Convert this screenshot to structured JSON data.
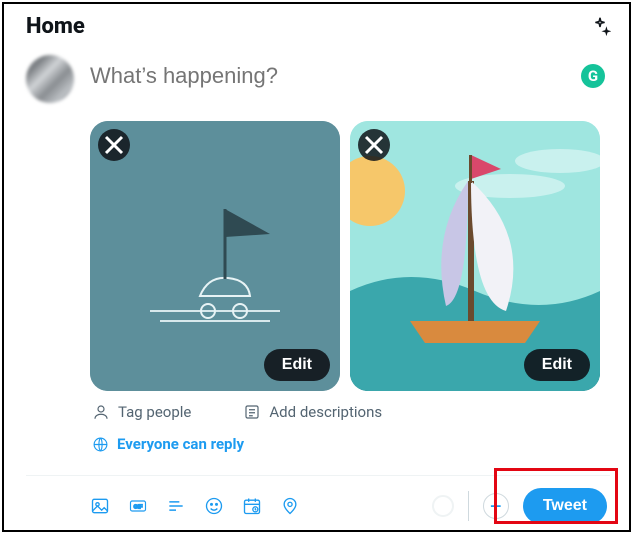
{
  "header": {
    "title": "Home"
  },
  "composer": {
    "placeholder": "What’s happening?",
    "grammarly_badge": "G",
    "media": [
      {
        "edit_label": "Edit"
      },
      {
        "edit_label": "Edit"
      }
    ],
    "tag_people_label": "Tag people",
    "add_descriptions_label": "Add descriptions",
    "reply_setting_label": "Everyone can reply",
    "tweet_button_label": "Tweet"
  },
  "colors": {
    "accent": "#1d9bf0",
    "text_muted": "#536471",
    "grammarly": "#15c39a",
    "highlight": "#e30613"
  }
}
